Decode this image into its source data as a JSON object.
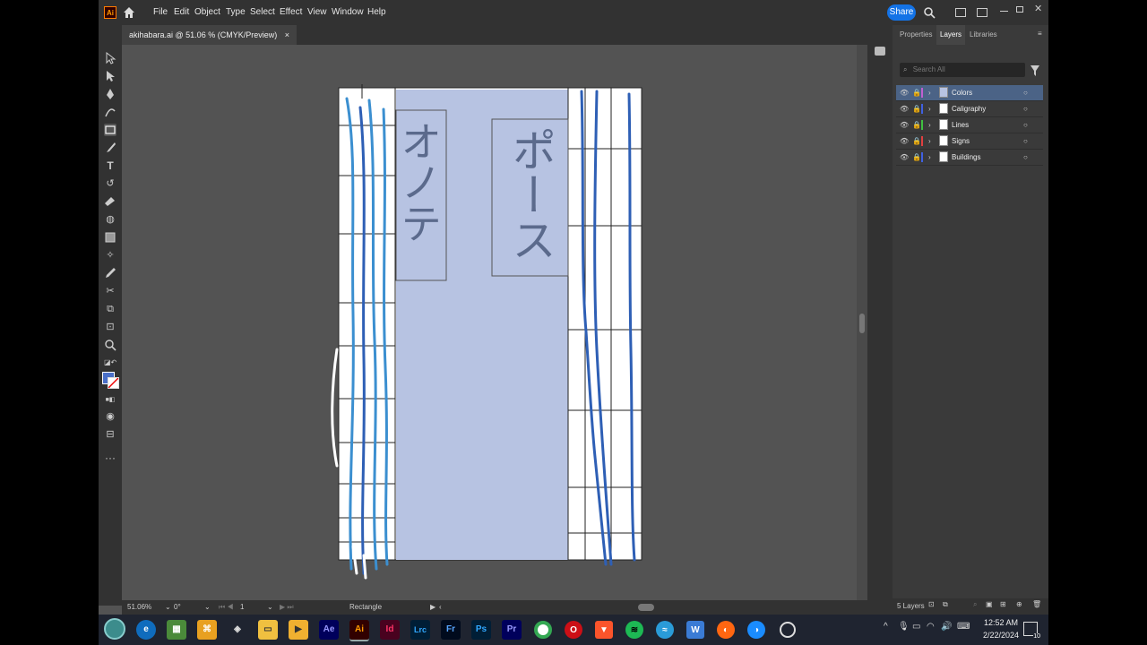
{
  "app": {
    "logo": "Ai",
    "menus": [
      "File",
      "Edit",
      "Object",
      "Type",
      "Select",
      "Effect",
      "View",
      "Window",
      "Help"
    ],
    "share_label": "Share"
  },
  "document": {
    "tab_title": "akihabara.ai @ 51.06 % (CMYK/Preview)",
    "tab_close": "×"
  },
  "tools": [
    "selection-tool",
    "direct-selection-tool",
    "pen-tool",
    "curvature-tool",
    "rectangle-tool",
    "paintbrush-tool",
    "type-tool",
    "rotate-tool",
    "eraser-tool",
    "shape-builder-tool",
    "gradient-tool",
    "eyedropper-tool",
    "blend-tool",
    "width-tool",
    "symbol-sprayer-tool",
    "artboard-tool",
    "zoom-tool"
  ],
  "artboard": {
    "sign_left_text": "オノテ",
    "sign_right_text": "ポース",
    "fill_color": "#b7c3e2"
  },
  "status": {
    "zoom": "51.06%",
    "rotation": "0°",
    "artboard_number": "1",
    "selected_tool": "Rectangle"
  },
  "panel": {
    "tabs": [
      "Properties",
      "Layers",
      "Libraries"
    ],
    "active_tab": "Layers",
    "search_placeholder": "Search All",
    "layers": [
      {
        "name": "Colors",
        "color": "#c060d0",
        "selected": true
      },
      {
        "name": "Caligraphy",
        "color": "#4060e0",
        "selected": false
      },
      {
        "name": "Lines",
        "color": "#40c040",
        "selected": false
      },
      {
        "name": "Signs",
        "color": "#e04040",
        "selected": false
      },
      {
        "name": "Buildings",
        "color": "#4060e0",
        "selected": false
      }
    ],
    "layer_count": "5 Layers"
  },
  "taskbar": {
    "apps": [
      {
        "name": "Ae",
        "color": "#00005b",
        "fg": "#9999ff"
      },
      {
        "name": "Ai",
        "color": "#310000",
        "fg": "#ff9a00"
      },
      {
        "name": "Id",
        "color": "#49021f",
        "fg": "#ff3366"
      },
      {
        "name": "Lrc",
        "color": "#001e36",
        "fg": "#31a8ff"
      },
      {
        "name": "Fr",
        "color": "#000b1d",
        "fg": "#58a6ff"
      },
      {
        "name": "Ps",
        "color": "#001e36",
        "fg": "#31a8ff"
      },
      {
        "name": "Pr",
        "color": "#00005b",
        "fg": "#9999ff"
      }
    ],
    "time": "12:52 AM",
    "date": "2/22/2024",
    "notifications": "10"
  }
}
